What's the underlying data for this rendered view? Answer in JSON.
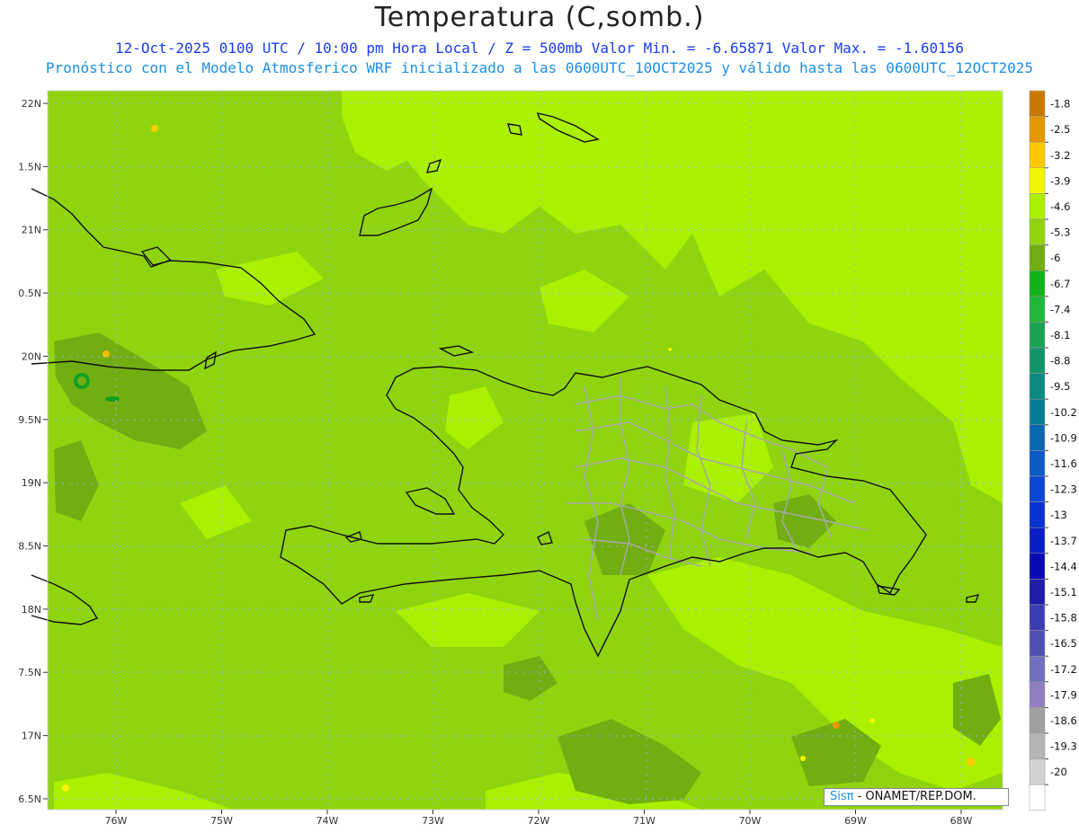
{
  "header": {
    "title": "Temperatura (C,somb.)",
    "subtitle": "12-Oct-2025  0100 UTC / 10:00 pm Hora Local / Z = 500mb  Valor Min. = -6.65871  Valor Max. = -1.60156",
    "subtitle2": "Pronóstico con el Modelo Atmosferico WRF inicializado a las 0600UTC_10OCT2025 y válido hasta las  0600UTC_12OCT2025"
  },
  "map": {
    "lat_labels": [
      "22N",
      "1.5N",
      "21N",
      "0.5N",
      "20N",
      "9.5N",
      "19N",
      "8.5N",
      "18N",
      "7.5N",
      "17N",
      "6.5N"
    ],
    "lon_labels": [
      "76W",
      "75W",
      "74W",
      "73W",
      "72W",
      "71W",
      "70W",
      "69W",
      "68W"
    ],
    "colors": {
      "base_green": "#8fd40f",
      "light_green": "#aaf000",
      "dark_green": "#72ad12",
      "coast": "#111111",
      "province_border": "#a8a8a8",
      "gridline": "#9ab0ff"
    }
  },
  "colorbar": {
    "levels": [
      {
        "label": "-1.8",
        "color": "#c87800"
      },
      {
        "label": "-2.5",
        "color": "#e69800"
      },
      {
        "label": "-3.2",
        "color": "#ffc800"
      },
      {
        "label": "-3.9",
        "color": "#f4f400"
      },
      {
        "label": "-4.6",
        "color": "#aaf000"
      },
      {
        "label": "-5.3",
        "color": "#8fd40f"
      },
      {
        "label": "-6",
        "color": "#72ad12"
      },
      {
        "label": "-6.7",
        "color": "#10b418"
      },
      {
        "label": "-7.4",
        "color": "#20b838"
      },
      {
        "label": "-8.1",
        "color": "#18a450"
      },
      {
        "label": "-8.8",
        "color": "#10966a"
      },
      {
        "label": "-9.5",
        "color": "#0a8c82"
      },
      {
        "label": "-10.2",
        "color": "#087e96"
      },
      {
        "label": "-10.9",
        "color": "#0868b4"
      },
      {
        "label": "-11.6",
        "color": "#0a5ac8"
      },
      {
        "label": "-12.3",
        "color": "#0a46d2"
      },
      {
        "label": "-13",
        "color": "#0a32d2"
      },
      {
        "label": "-13.7",
        "color": "#0a1ec8"
      },
      {
        "label": "-14.4",
        "color": "#0a0ab4"
      },
      {
        "label": "-15.1",
        "color": "#1e1eaa"
      },
      {
        "label": "-15.8",
        "color": "#3c3cb4"
      },
      {
        "label": "-16.5",
        "color": "#5050b4"
      },
      {
        "label": "-17.2",
        "color": "#7070be"
      },
      {
        "label": "-17.9",
        "color": "#9080c0"
      },
      {
        "label": "-18.6",
        "color": "#a0a0a0"
      },
      {
        "label": "-19.3",
        "color": "#b4b4b4"
      },
      {
        "label": "-20",
        "color": "#d2d2d2"
      },
      {
        "label": "",
        "color": "#ffffff"
      }
    ]
  },
  "credit": {
    "brand": "Sisπ",
    "org": " - ONAMET/REP.DOM."
  }
}
